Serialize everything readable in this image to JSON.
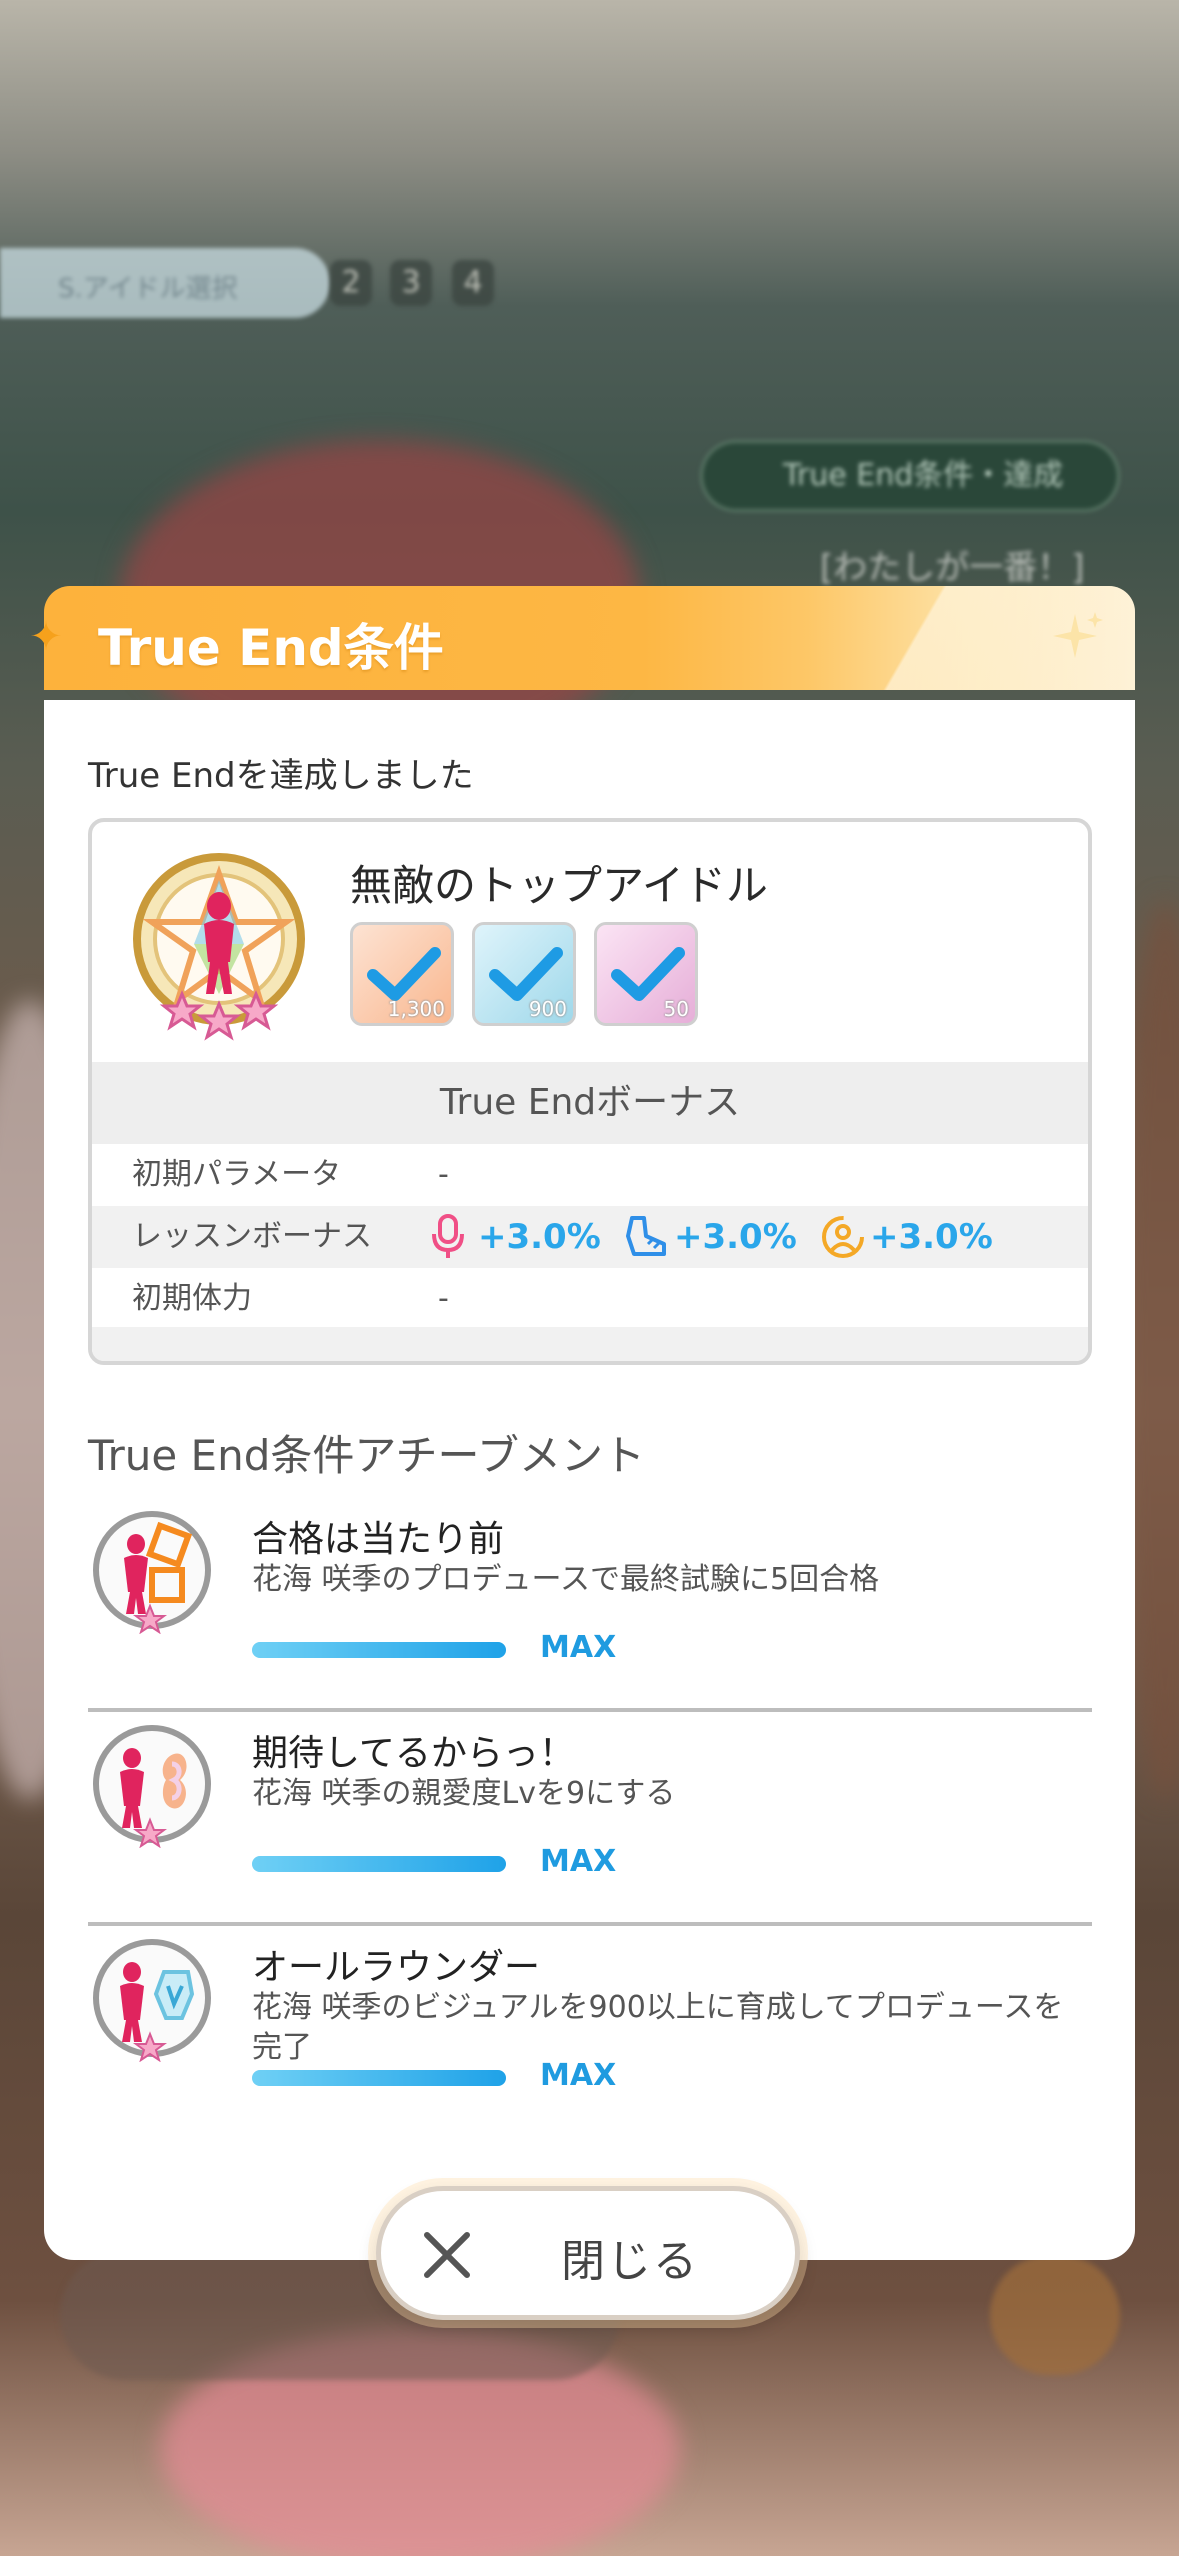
{
  "background": {
    "tab_pill_label": "S.アイドル選択",
    "tab_numbers": [
      "2",
      "3",
      "4"
    ],
    "chip_label": "True End条件・達成",
    "sub_label": "[わたしが一番！]"
  },
  "dialog": {
    "title": "True End条件",
    "subtitle": "True Endを達成しました",
    "accent_color": "#fdb23c",
    "card": {
      "idol_title": "無敵のトップアイドル",
      "requirements": [
        {
          "icon": "vocal-check-icon",
          "value": "1,300",
          "tint": "#f6a08a"
        },
        {
          "icon": "dance-check-icon",
          "value": "900",
          "tint": "#8fd4e8"
        },
        {
          "icon": "visual-check-icon",
          "value": "50",
          "tint": "#e7a6d8"
        }
      ],
      "bonus_header": "True Endボーナス",
      "rows": {
        "initial_param_label": "初期パラメータ",
        "initial_param_value": "-",
        "lesson_bonus_label": "レッスンボーナス",
        "lesson_bonuses": [
          {
            "icon": "vocal-icon",
            "value": "+3.0%",
            "color": "#f04f86"
          },
          {
            "icon": "dance-icon",
            "value": "+3.0%",
            "color": "#2f8fe8"
          },
          {
            "icon": "visual-icon",
            "value": "+3.0%",
            "color": "#f4a826"
          }
        ],
        "initial_stamina_label": "初期体力",
        "initial_stamina_value": "-"
      }
    },
    "achievements_heading": "True End条件アチーブメント",
    "achievements": [
      {
        "title": "合格は当たり前",
        "description": "花海 咲季のプロデュースで最終試験に5回合格",
        "progress": 1.0,
        "status": "MAX",
        "icon": "exam-achievement-icon"
      },
      {
        "title": "期待してるからっ！",
        "description": "花海 咲季の親愛度Lvを9にする",
        "progress": 1.0,
        "status": "MAX",
        "icon": "affection-achievement-icon"
      },
      {
        "title": "オールラウンダー",
        "description": "花海 咲季のビジュアルを900以上に育成してプロデュースを完了",
        "progress": 1.0,
        "status": "MAX",
        "icon": "visual-achievement-icon"
      }
    ],
    "close_label": "閉じる"
  }
}
